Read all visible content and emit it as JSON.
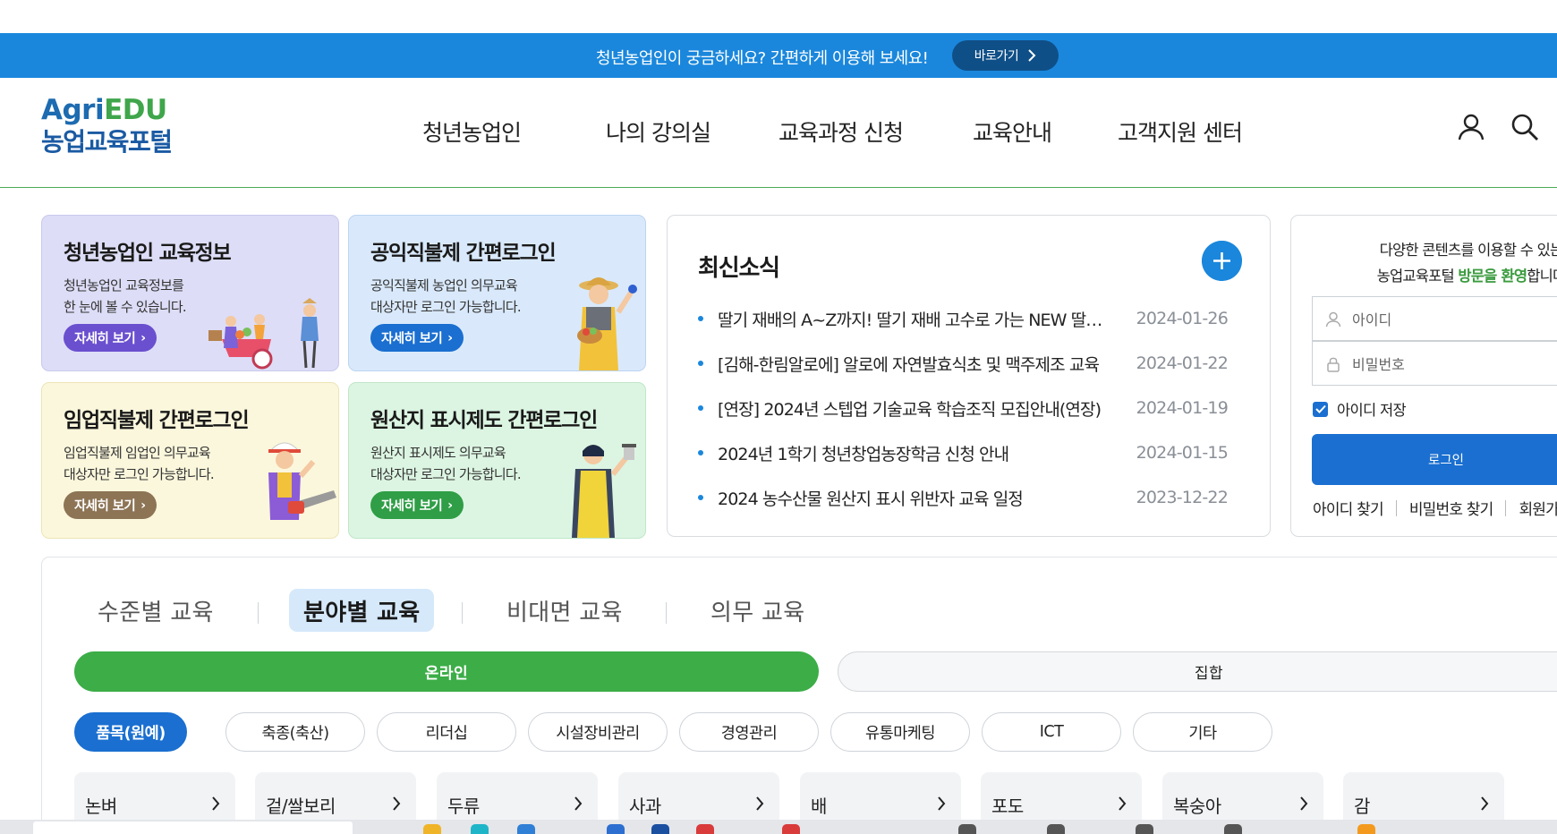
{
  "promo": {
    "text": "청년농업인이 궁금하세요? 간편하게 이용해 보세요!",
    "button": "바로가기"
  },
  "logo": {
    "en_prefix": "Agri",
    "en_suffix": "EDU",
    "ko": "농업교육포털"
  },
  "nav": [
    "청년농업인",
    "나의 강의실",
    "교육과정 신청",
    "교육안내",
    "고객지원 센터"
  ],
  "header_icons": [
    "user-icon",
    "search-icon"
  ],
  "cards": [
    {
      "title": "청년농업인 교육정보",
      "desc": "청년농업인 교육정보를\n한 눈에 볼 수 있습니다.",
      "button": "자세히 보기",
      "bg": "#ddddf7",
      "btn_color": "#6a4fcf"
    },
    {
      "title": "공익직불제 간편로그인",
      "desc": "공익직불제 농업인 의무교육\n대상자만 로그인 가능합니다.",
      "button": "자세히 보기",
      "bg": "#d9e9fb",
      "btn_color": "#1a6fd0"
    },
    {
      "title": "임업직불제 간편로그인",
      "desc": "임업직불제 임업인 의무교육\n대상자만 로그인 가능합니다.",
      "button": "자세히 보기",
      "bg": "#fbf7dc",
      "btn_color": "#8c7455"
    },
    {
      "title": "원산지 표시제도 간편로그인",
      "desc": "원산지 표시제도 의무교육\n대상자만 로그인 가능합니다.",
      "button": "자세히 보기",
      "bg": "#dcf5e2",
      "btn_color": "#2f9e46"
    }
  ],
  "news": {
    "title": "최신소식",
    "items": [
      {
        "text": "딸기 재배의 A~Z까지! 딸기 재배 고수로 가는 NEW 딸기 재배 비법",
        "date": "2024-01-26"
      },
      {
        "text": "[김해-한림알로에] 알로에 자연발효식초 및 맥주제조 교육",
        "date": "2024-01-22"
      },
      {
        "text": "[연장] 2024년 스텝업 기술교육 학습조직 모집안내(연장)",
        "date": "2024-01-19"
      },
      {
        "text": "2024년 1학기 청년창업농장학금 신청 안내",
        "date": "2024-01-15"
      },
      {
        "text": "2024 농수산물 원산지 표시 위반자 교육 일정",
        "date": "2023-12-22"
      }
    ]
  },
  "login": {
    "msg_line1": "다양한 콘텐츠를 이용할 수 있는",
    "msg_line2_a": "농업교육포털 ",
    "msg_line2_hl": "방문을 환영",
    "msg_line2_b": "합니다",
    "id_placeholder": "아이디",
    "pw_placeholder": "비밀번호",
    "save_id": "아이디 저장",
    "login_button": "로그인",
    "links": [
      "아이디 찾기",
      "비밀번호 찾기",
      "회원가입"
    ]
  },
  "course": {
    "tabs": [
      "수준별 교육",
      "분야별 교육",
      "비대면 교육",
      "의무 교육"
    ],
    "active_tab": 1,
    "modes": [
      "온라인",
      "집합"
    ],
    "chips": [
      "품목(원예)",
      "축종(축산)",
      "리더십",
      "시설장비관리",
      "경영관리",
      "유통마케팅",
      "ICT",
      "기타"
    ],
    "crops": [
      "논벼",
      "겉/쌀보리",
      "두류",
      "사과",
      "배",
      "포도",
      "복숭아",
      "감"
    ]
  },
  "colors": {
    "primary_blue": "#1a87dc",
    "nav_dark": "#0f4f87",
    "green": "#3fa64b",
    "login_blue": "#1a6fd0"
  }
}
